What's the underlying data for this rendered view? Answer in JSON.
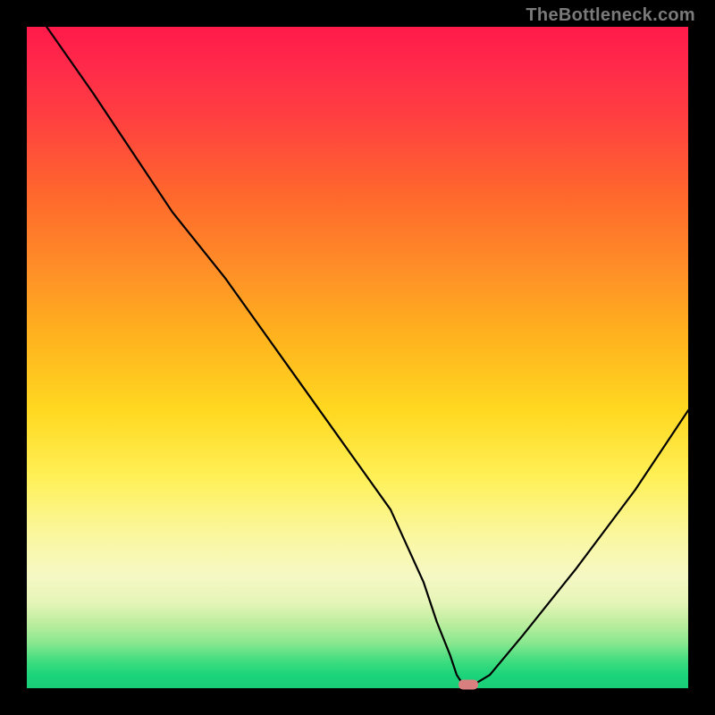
{
  "watermark": "TheBottleneck.com",
  "chart_data": {
    "type": "line",
    "title": "",
    "xlabel": "",
    "ylabel": "",
    "x_range": [
      0,
      100
    ],
    "y_range": [
      0,
      100
    ],
    "series": [
      {
        "name": "curve",
        "x": [
          3,
          10,
          22,
          30,
          40,
          50,
          55,
          60,
          62,
          64,
          65,
          66,
          67.5,
          70,
          75,
          83,
          92,
          100
        ],
        "y": [
          100,
          90,
          72,
          62,
          48,
          34,
          27,
          16,
          10,
          5,
          2,
          0.5,
          0.5,
          2,
          8,
          18,
          30,
          42
        ]
      }
    ],
    "marker": {
      "x": 66.7,
      "y": 0.5,
      "shape": "pill",
      "color": "#d97f80"
    },
    "gradient_stops": [
      {
        "pos": 0,
        "color": "#ff1a4a"
      },
      {
        "pos": 50,
        "color": "#ffd820"
      },
      {
        "pos": 85,
        "color": "#f6f8c4"
      },
      {
        "pos": 100,
        "color": "#18cf78"
      }
    ]
  }
}
